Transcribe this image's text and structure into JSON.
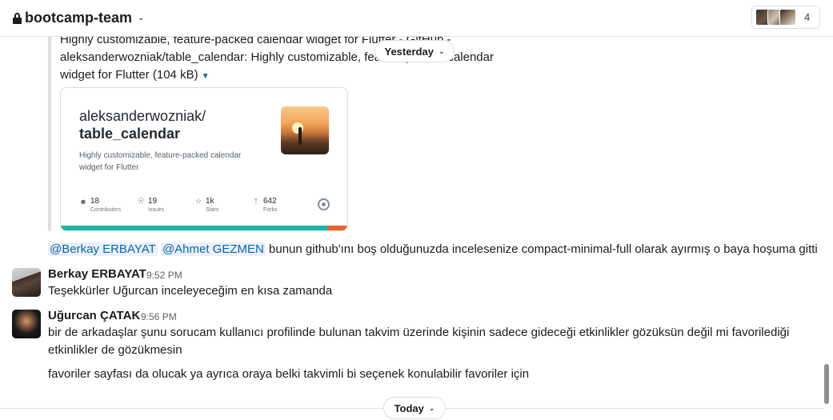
{
  "header": {
    "channel_name": "bootcamp-team",
    "member_count": "4"
  },
  "unfurl": {
    "text": "Highly customizable, feature-packed calendar widget for Flutter - GitHub - aleksanderwozniak/table_calendar: Highly customizable, feature-packed calendar widget for Flutter (104 kB)",
    "card": {
      "owner": "aleksanderwozniak/",
      "repo": "table_calendar",
      "description": "Highly customizable, feature-packed calendar widget for Flutter",
      "stats": [
        {
          "icon": "contributors-icon",
          "value": "18",
          "label": "Contributors"
        },
        {
          "icon": "issues-icon",
          "value": "19",
          "label": "Issues"
        },
        {
          "icon": "stars-icon",
          "value": "1k",
          "label": "Stars"
        },
        {
          "icon": "forks-icon",
          "value": "642",
          "label": "Forks"
        }
      ]
    }
  },
  "dividers": {
    "yesterday": "Yesterday",
    "today": "Today"
  },
  "messages": {
    "m1": {
      "mention1": "@Berkay ERBAYAT",
      "mention2": "@Ahmet GEZMEN",
      "text": "bunun github'ını boş olduğunuzda incelesenize compact-minimal-full olarak ayırmış o baya hoşuma gitti"
    },
    "m2": {
      "author": "Berkay ERBAYAT",
      "time": "9:52 PM",
      "text": "Teşekkürler Uğurcan inceleyeceğim en kısa zamanda"
    },
    "m3": {
      "author": "Uğurcan ÇATAK",
      "time": "9:56 PM",
      "line1": "bir de arkadaşlar şunu sorucam kullanıcı profilinde bulunan takvim üzerinde kişinin sadece gideceği etkinlikler gözüksün değil mi favorilediği",
      "line2": "etkinlikler de gözükmesin",
      "line3": "favoriler sayfası da olucak ya ayrıca oraya belki takvimli bi seçenek konulabilir favoriler için"
    }
  },
  "colors": {
    "mention_text": "#1264a3",
    "mention_bg": "#e8f1fa",
    "card_strip": "#1fb2a6"
  }
}
